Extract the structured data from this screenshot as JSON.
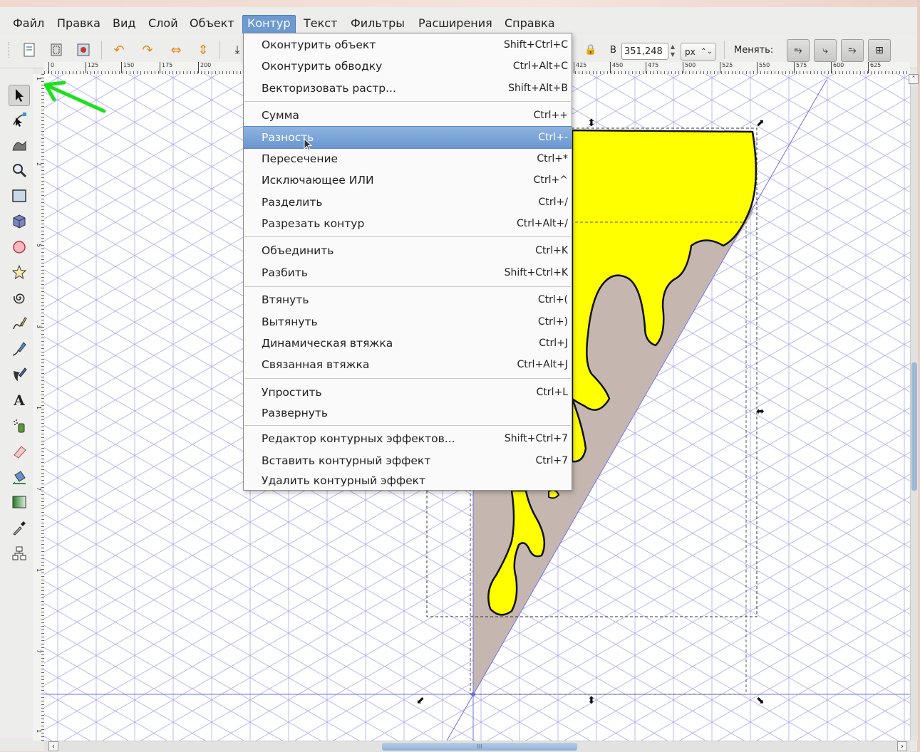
{
  "menubar": {
    "items": [
      "Файл",
      "Правка",
      "Вид",
      "Слой",
      "Объект",
      "Контур",
      "Текст",
      "Фильтры",
      "Расширения",
      "Справка"
    ],
    "active": "Контур"
  },
  "toolbar": {
    "height_label": "В",
    "height_value": "351,248",
    "unit": "px",
    "change_label": "Менять:"
  },
  "ruler": {
    "h_ticks": [
      "0",
      "125",
      "150",
      "175",
      "200",
      "425",
      "450",
      "475",
      "500",
      "525",
      "550",
      "575",
      "600",
      "625"
    ],
    "v_ticks": [
      "1",
      "2",
      "5",
      "3",
      "1",
      "7",
      "1",
      "7",
      "1"
    ]
  },
  "path_menu": {
    "items": [
      {
        "label": "Оконтурить объект",
        "shortcut": "Shift+Ctrl+C"
      },
      {
        "label": "Оконтурить обводку",
        "shortcut": "Ctrl+Alt+C"
      },
      {
        "label": "Векторизовать растр...",
        "shortcut": "Shift+Alt+B"
      },
      {
        "label": "Сумма",
        "shortcut": "Ctrl++"
      },
      {
        "label": "Разность",
        "shortcut": "Ctrl+-"
      },
      {
        "label": "Пересечение",
        "shortcut": "Ctrl+*"
      },
      {
        "label": "Исключающее ИЛИ",
        "shortcut": "Ctrl+^"
      },
      {
        "label": "Разделить",
        "shortcut": "Ctrl+/"
      },
      {
        "label": "Разрезать контур",
        "shortcut": "Ctrl+Alt+/"
      },
      {
        "label": "Объединить",
        "shortcut": "Ctrl+K"
      },
      {
        "label": "Разбить",
        "shortcut": "Shift+Ctrl+K"
      },
      {
        "label": "Втянуть",
        "shortcut": "Ctrl+("
      },
      {
        "label": "Вытянуть",
        "shortcut": "Ctrl+)"
      },
      {
        "label": "Динамическая втяжка",
        "shortcut": "Ctrl+J"
      },
      {
        "label": "Связанная втяжка",
        "shortcut": "Ctrl+Alt+J"
      },
      {
        "label": "Упростить",
        "shortcut": "Ctrl+L"
      },
      {
        "label": "Развернуть",
        "shortcut": ""
      },
      {
        "label": "Редактор контурных эффектов...",
        "shortcut": "Shift+Ctrl+7"
      },
      {
        "label": "Вставить контурный эффект",
        "shortcut": "Ctrl+7"
      },
      {
        "label": "Удалить контурный эффект",
        "shortcut": ""
      }
    ],
    "highlighted": "Разность"
  },
  "colors": {
    "accent": "#6a97d1",
    "shape_fill": "#ffff00",
    "triangle_fill": "#c8b8b0",
    "grid": "#a9a9f0",
    "annotation_arrow": "#1fe01f"
  },
  "icons": {
    "tools": [
      "selector-icon",
      "node-icon",
      "tweak-icon",
      "zoom-icon",
      "rectangle-icon",
      "3d-box-icon",
      "circle-icon",
      "star-icon",
      "spiral-icon",
      "pencil-icon",
      "pen-icon",
      "calligraphy-icon",
      "text-icon",
      "spray-icon",
      "eraser-icon",
      "paint-bucket-icon",
      "gradient-icon",
      "dropper-icon",
      "connector-icon"
    ]
  }
}
